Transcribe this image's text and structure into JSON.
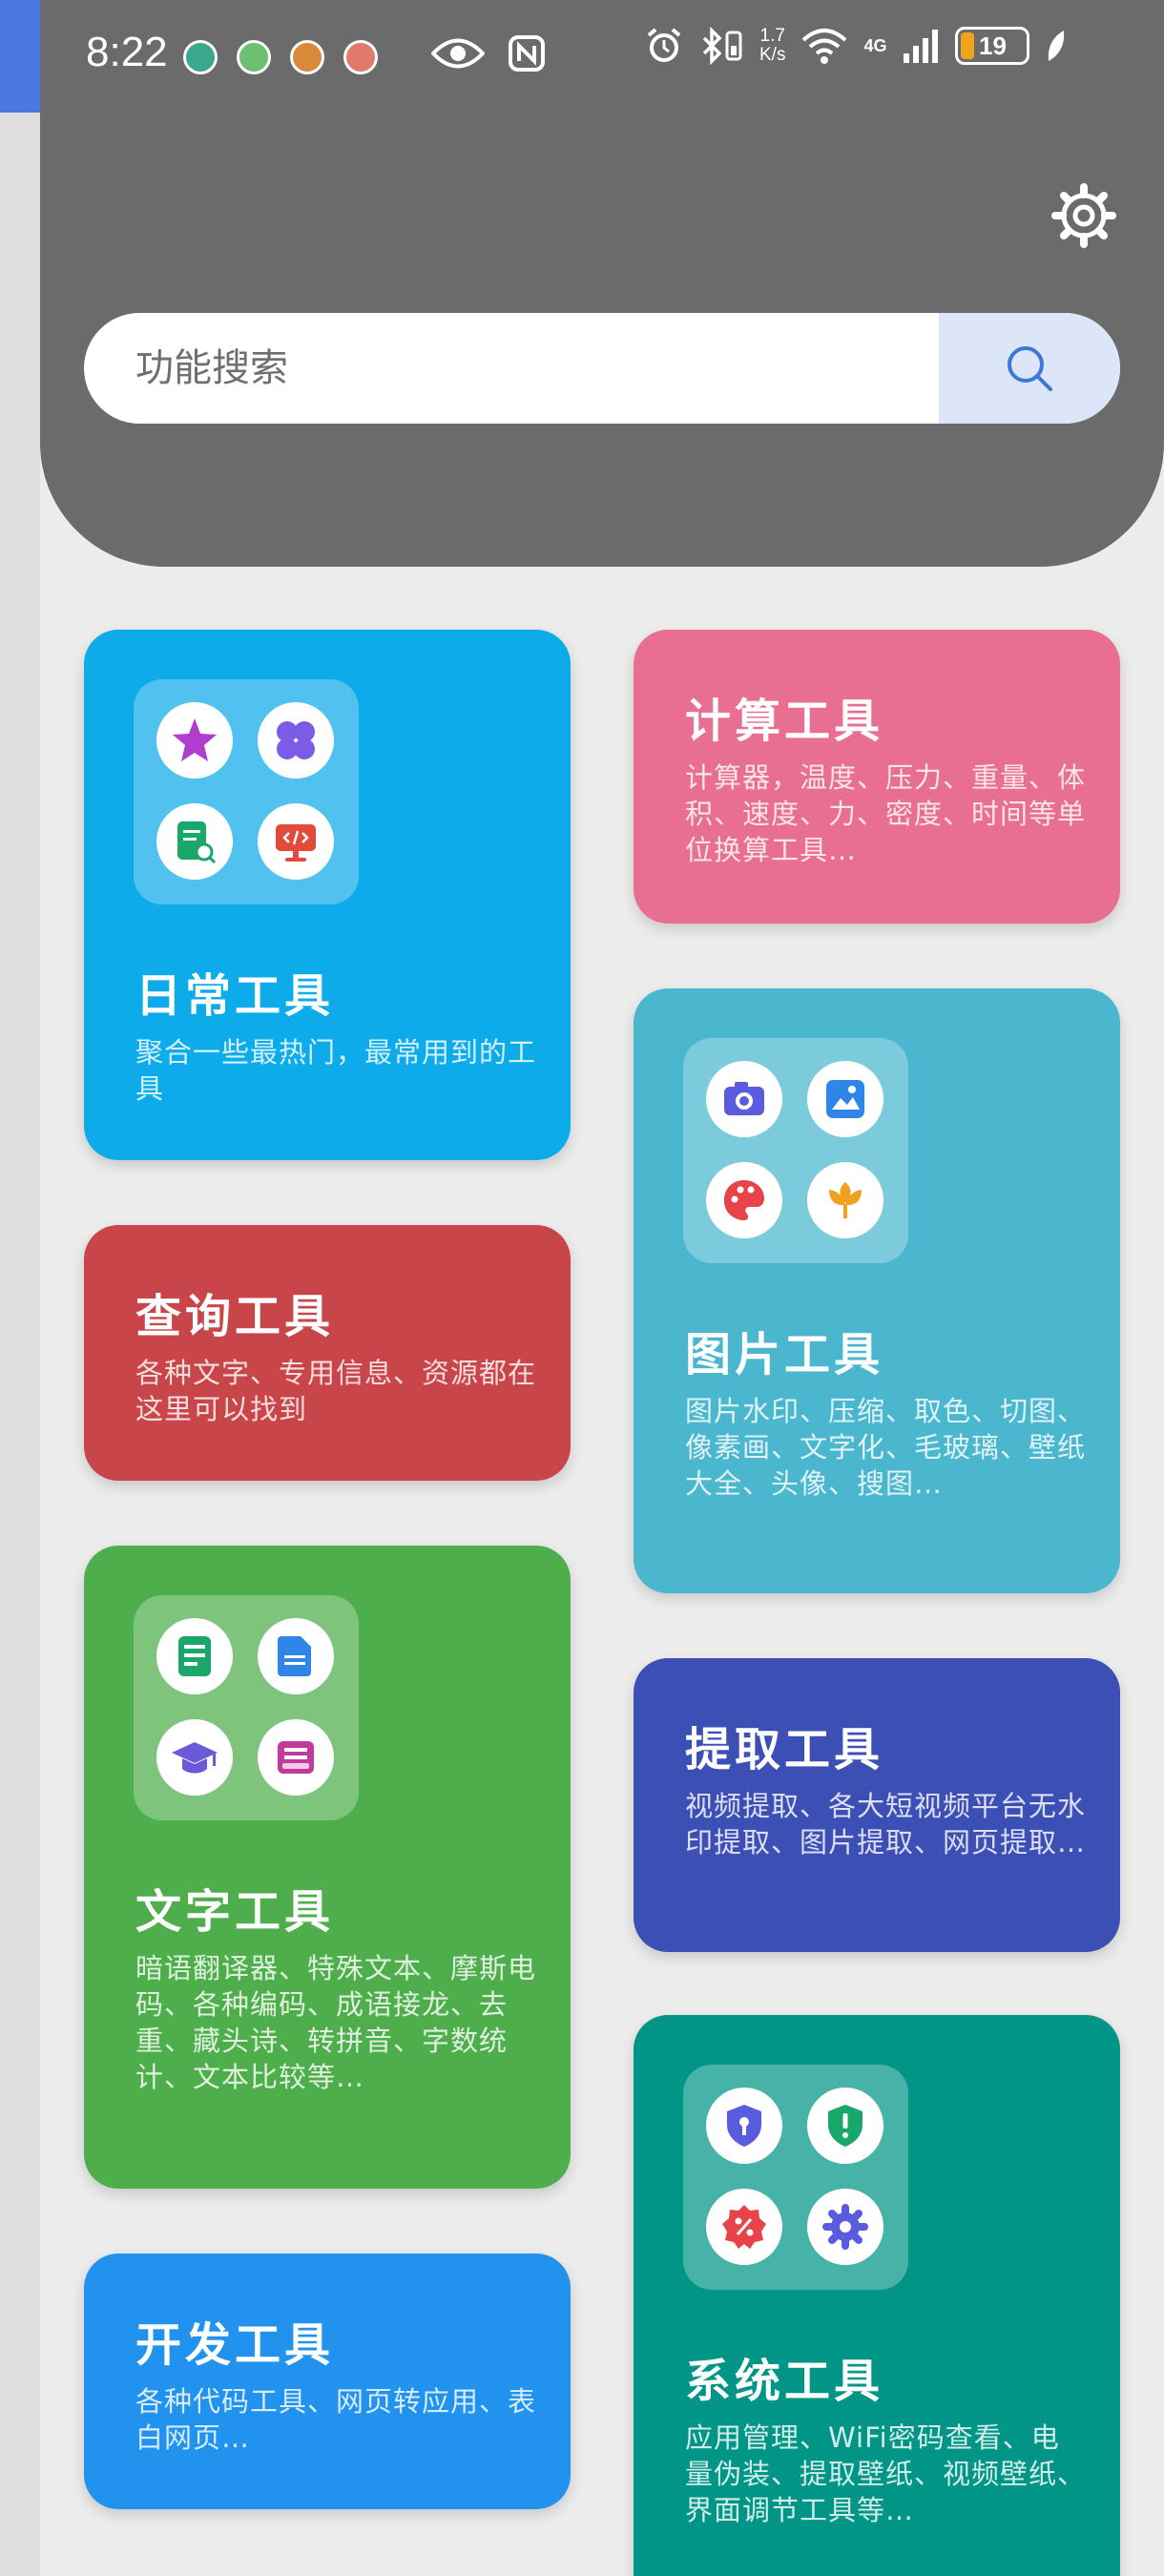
{
  "status_bar": {
    "time": "8:22",
    "speed_value": "1.7",
    "speed_unit": "K/s",
    "network": "4G",
    "battery": "19"
  },
  "search": {
    "placeholder": "功能搜索"
  },
  "tools": [
    {
      "title": "日常工具",
      "desc": "聚合一些最热门，最常用到的工具",
      "color": "#0eabea"
    },
    {
      "title": "计算工具",
      "desc": "计算器，温度、压力、重量、体积、速度、力、密度、时间等单位换算工具…",
      "color": "#e86f91"
    },
    {
      "title": "查询工具",
      "desc": "各种文字、专用信息、资源都在这里可以找到",
      "color": "#c84549"
    },
    {
      "title": "图片工具",
      "desc": "图片水印、压缩、取色、切图、像素画、文字化、毛玻璃、壁纸大全、头像、搜图…",
      "color": "#4ab7cf"
    },
    {
      "title": "文字工具",
      "desc": "暗语翻译器、特殊文本、摩斯电码、各种编码、成语接龙、去重、藏头诗、转拼音、字数统计、文本比较等…",
      "color": "#4eae4c"
    },
    {
      "title": "提取工具",
      "desc": "视频提取、各大短视频平台无水印提取、图片提取、网页提取…",
      "color": "#3c4fb4"
    },
    {
      "title": "开发工具",
      "desc": "各种代码工具、网页转应用、表白网页…",
      "color": "#2193ef"
    },
    {
      "title": "系统工具",
      "desc": "应用管理、WiFi密码查看、电量伪装、提取壁纸、视频壁纸、界面调节工具等…",
      "color": "#009586"
    }
  ]
}
